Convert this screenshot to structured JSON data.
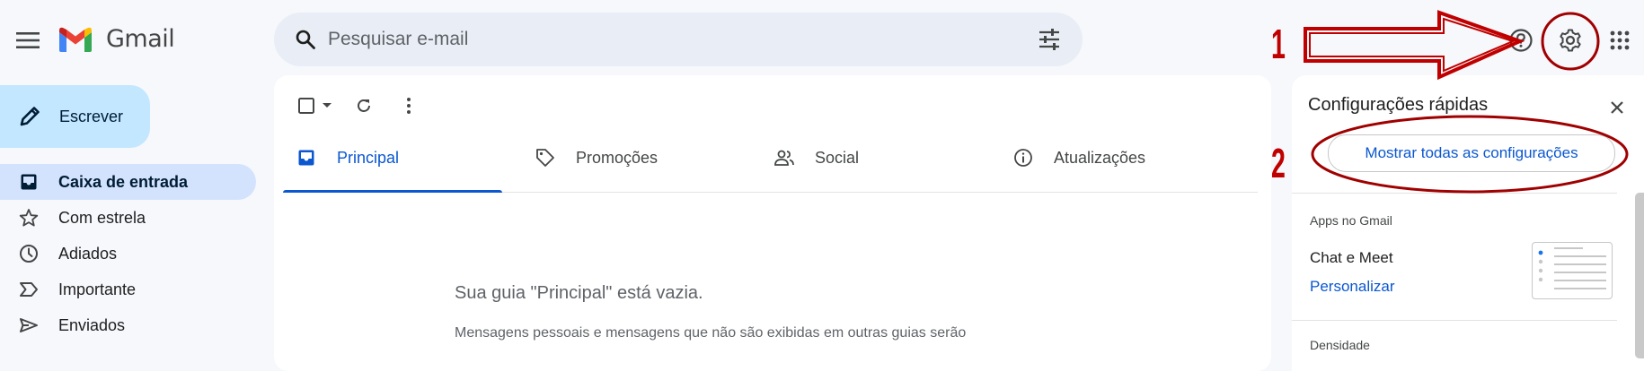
{
  "app": {
    "name": "Gmail",
    "brand_colors": {
      "red": "#ea4335",
      "blue": "#4285f4",
      "green": "#34a853",
      "yellow": "#fbbc04"
    }
  },
  "search": {
    "placeholder": "Pesquisar e-mail",
    "value": "",
    "filter_icon": "tune-icon"
  },
  "header_icons": [
    "help-icon",
    "settings-icon",
    "apps-grid-icon"
  ],
  "annotations": {
    "step1": "1",
    "step2": "2",
    "color": "#c00000"
  },
  "compose": {
    "label": "Escrever"
  },
  "sidebar": {
    "items": [
      {
        "label": "Caixa de entrada",
        "icon": "inbox-icon",
        "active": true
      },
      {
        "label": "Com estrela",
        "icon": "star-icon",
        "active": false
      },
      {
        "label": "Adiados",
        "icon": "clock-icon",
        "active": false
      },
      {
        "label": "Importante",
        "icon": "important-icon",
        "active": false
      },
      {
        "label": "Enviados",
        "icon": "send-icon",
        "active": false
      }
    ]
  },
  "toolbar": {
    "icons": [
      "select-checkbox",
      "select-dropdown-icon",
      "refresh-icon",
      "more-vert-icon"
    ]
  },
  "tabs": [
    {
      "label": "Principal",
      "icon": "inbox-tab-icon",
      "active": true
    },
    {
      "label": "Promoções",
      "icon": "tag-icon",
      "active": false
    },
    {
      "label": "Social",
      "icon": "people-icon",
      "active": false
    },
    {
      "label": "Atualizações",
      "icon": "info-icon",
      "active": false
    }
  ],
  "empty_state": {
    "title": "Sua guia \"Principal\" está vazia.",
    "description": "Mensagens pessoais e mensagens que não são exibidas em outras guias serão"
  },
  "quick_settings": {
    "title": "Configurações rápidas",
    "show_all_button": "Mostrar todas as configurações",
    "apps_section": "Apps no Gmail",
    "chat_meet_label": "Chat e Meet",
    "customize_link": "Personalizar",
    "density_section": "Densidade"
  }
}
